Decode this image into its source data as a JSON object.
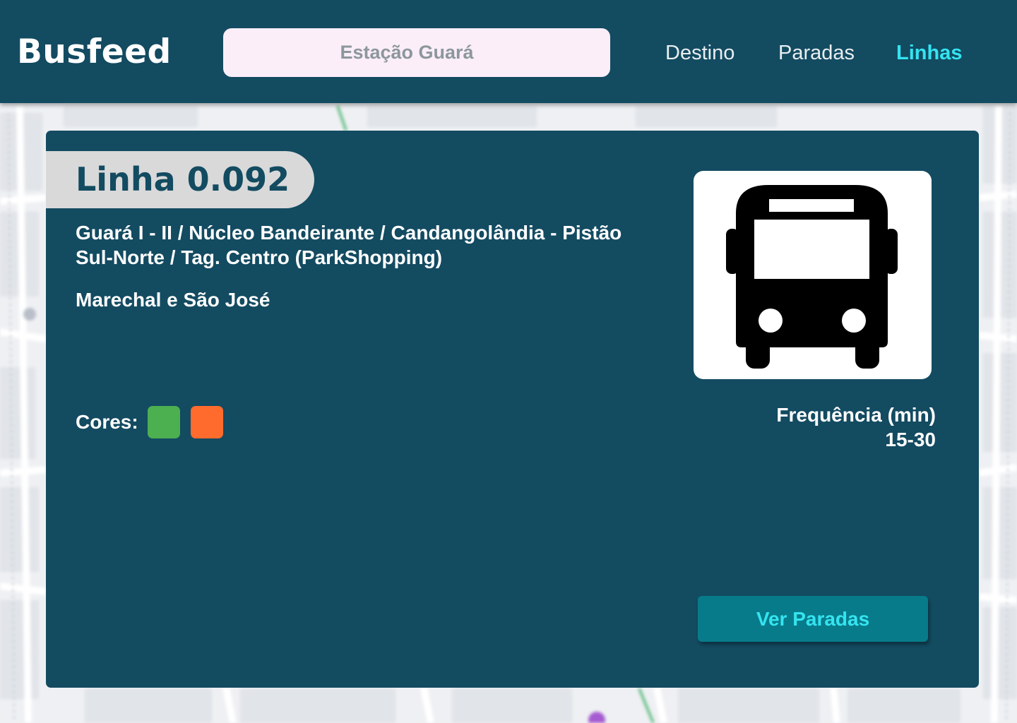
{
  "header": {
    "logo": "Busfeed",
    "search": {
      "value": "",
      "placeholder": "Estação Guará"
    },
    "nav": [
      {
        "label": "Destino",
        "active": false
      },
      {
        "label": "Paradas",
        "active": false
      },
      {
        "label": "Linhas",
        "active": true
      }
    ]
  },
  "line": {
    "title": "Linha 0.092",
    "route": "Guará I - II / Núcleo Bandeirante / Candangolândia - Pistão Sul-Norte / Tag. Centro (ParkShopping)",
    "street": "Marechal e São José",
    "colors_label": "Cores:",
    "colors": [
      "#4caf50",
      "#ff6b2c"
    ],
    "vehicle_icon": "bus-icon",
    "frequency": {
      "label": "Frequência (min)",
      "value": "15-30"
    },
    "view_stops_label": "Ver Paradas"
  },
  "theme": {
    "primary": "#134b61",
    "accent": "#34e4f0",
    "button": "#087b8a",
    "search_bg": "#fbeef8",
    "tag_bg": "#d9d9d9"
  }
}
